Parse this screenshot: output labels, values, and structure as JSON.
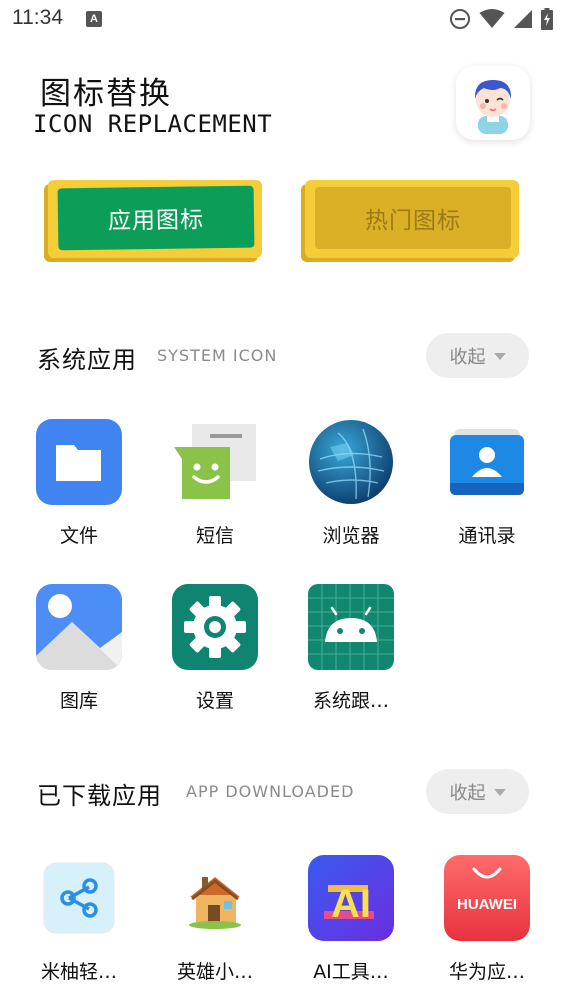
{
  "status_bar": {
    "time": "11:34",
    "notification_letter": "A"
  },
  "header": {
    "title_cn": "图标替换",
    "title_en": "ICON REPLACEMENT"
  },
  "tabs": [
    {
      "label": "应用图标",
      "active": true
    },
    {
      "label": "热门图标",
      "active": false
    }
  ],
  "system_section": {
    "title": "系统应用",
    "subtitle": "SYSTEM ICON",
    "collapse_label": "收起",
    "apps": [
      {
        "label": "文件",
        "icon": "folder-icon"
      },
      {
        "label": "短信",
        "icon": "messages-icon"
      },
      {
        "label": "浏览器",
        "icon": "browser-globe-icon"
      },
      {
        "label": "通讯录",
        "icon": "contacts-icon"
      },
      {
        "label": "图库",
        "icon": "gallery-icon"
      },
      {
        "label": "设置",
        "icon": "settings-gear-icon"
      },
      {
        "label": "系统跟…",
        "icon": "android-icon"
      }
    ]
  },
  "downloaded_section": {
    "title": "已下载应用",
    "subtitle": "APP DOWNLOADED",
    "collapse_label": "收起",
    "apps": [
      {
        "label": "米柚轻…",
        "icon": "share-icon"
      },
      {
        "label": "英雄小…",
        "icon": "house-icon"
      },
      {
        "label": "AI工具…",
        "icon": "ai-tools-icon",
        "icon_text": "AI"
      },
      {
        "label": "华为应…",
        "icon": "huawei-appgallery-icon",
        "icon_text": "HUAWEI"
      }
    ]
  },
  "colors": {
    "accent_green": "#0c9e58",
    "accent_yellow": "#f5cd38",
    "muted_gray": "#8a8a8a"
  }
}
